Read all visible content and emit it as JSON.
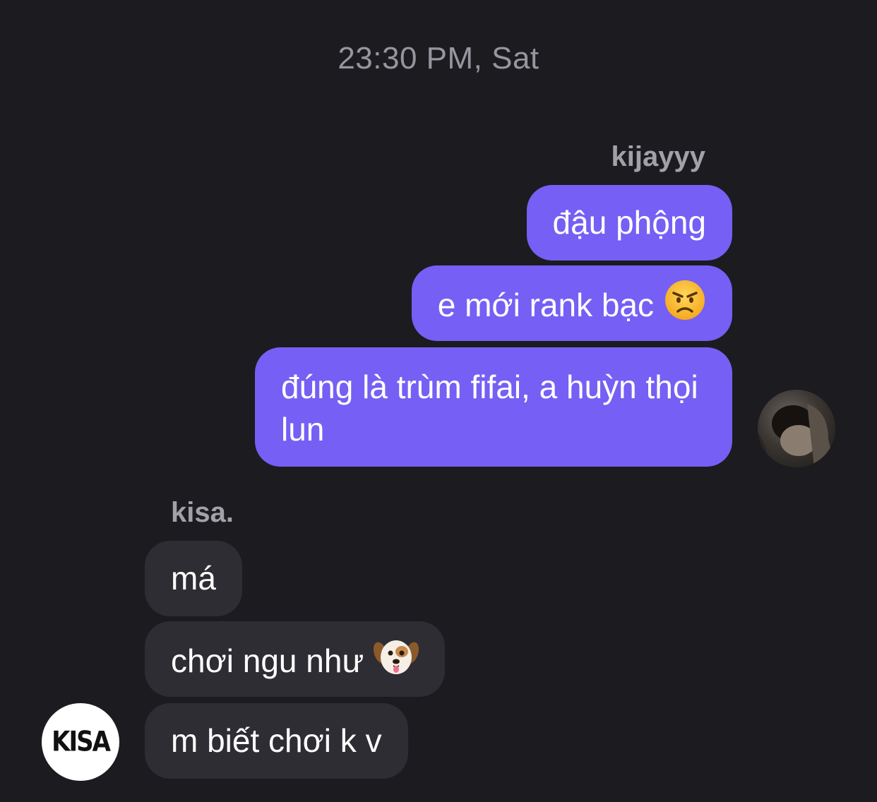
{
  "conversation": {
    "timestamp": "23:30 PM, Sat"
  },
  "outgoing": {
    "sender_name": "kijayyy",
    "avatar_icon": "profile-photo",
    "bubble_color": "#765ff4",
    "messages": [
      {
        "text": "đậu phộng"
      },
      {
        "text": "e mới rank bạc",
        "emoji": "angry-face"
      },
      {
        "text": "đúng là trùm fifai, a huỳn thọi lun"
      }
    ]
  },
  "incoming": {
    "sender_name": "kisa.",
    "avatar_logo": "KISA",
    "bubble_color": "#2e2d33",
    "messages": [
      {
        "text": "má"
      },
      {
        "text": "chơi ngu như",
        "emoji": "dog-face"
      },
      {
        "text": "m biết chơi k v"
      }
    ]
  }
}
